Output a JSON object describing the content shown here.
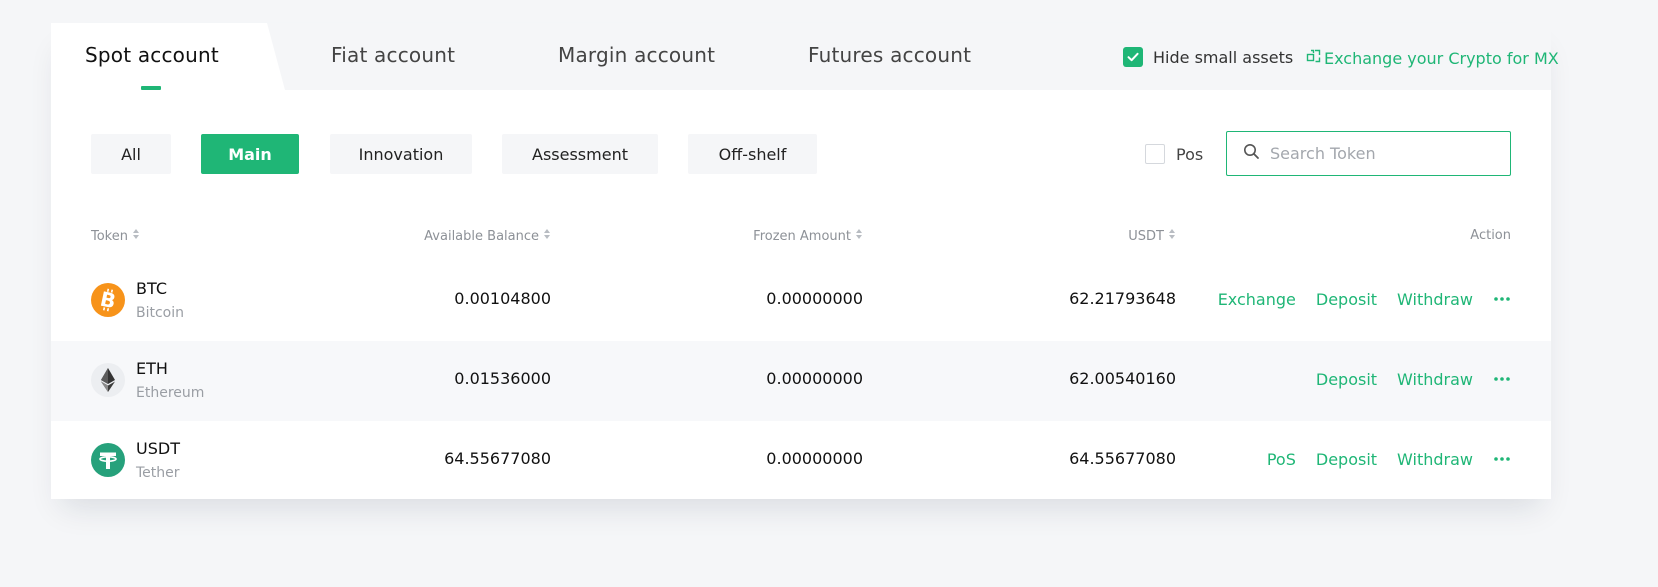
{
  "tabs": [
    {
      "label": "Spot account",
      "active": true
    },
    {
      "label": "Fiat account",
      "active": false
    },
    {
      "label": "Margin account",
      "active": false
    },
    {
      "label": "Futures account",
      "active": false
    }
  ],
  "hide_small_assets": {
    "label": "Hide small assets",
    "checked": true
  },
  "exchange_link": {
    "label": "Exchange your Crypto for MX",
    "icon": "exchange-icon"
  },
  "filters": [
    {
      "label": "All",
      "active": false
    },
    {
      "label": "Main",
      "active": true
    },
    {
      "label": "Innovation",
      "active": false
    },
    {
      "label": "Assessment",
      "active": false
    },
    {
      "label": "Off-shelf",
      "active": false
    }
  ],
  "pos_filter": {
    "label": "Pos",
    "checked": false
  },
  "search": {
    "placeholder": "Search Token",
    "value": ""
  },
  "table": {
    "headers": {
      "token": "Token",
      "available": "Available Balance",
      "frozen": "Frozen Amount",
      "usdt": "USDT",
      "action": "Action"
    },
    "rows": [
      {
        "symbol": "BTC",
        "name": "Bitcoin",
        "available": "0.00104800",
        "frozen": "0.00000000",
        "usdt": "62.21793648",
        "actions": [
          "Exchange",
          "Deposit",
          "Withdraw"
        ],
        "icon": "bitcoin-icon",
        "icon_color": "#f7931a"
      },
      {
        "symbol": "ETH",
        "name": "Ethereum",
        "available": "0.01536000",
        "frozen": "0.00000000",
        "usdt": "62.00540160",
        "actions": [
          "Deposit",
          "Withdraw"
        ],
        "icon": "ethereum-icon",
        "icon_color": "#eceef1"
      },
      {
        "symbol": "USDT",
        "name": "Tether",
        "available": "64.55677080",
        "frozen": "0.00000000",
        "usdt": "64.55677080",
        "actions": [
          "PoS",
          "Deposit",
          "Withdraw"
        ],
        "icon": "tether-icon",
        "icon_color": "#26a17b"
      }
    ]
  },
  "colors": {
    "accent": "#1fb676",
    "background": "#f5f6f8",
    "muted_text": "#9a9ea4"
  }
}
